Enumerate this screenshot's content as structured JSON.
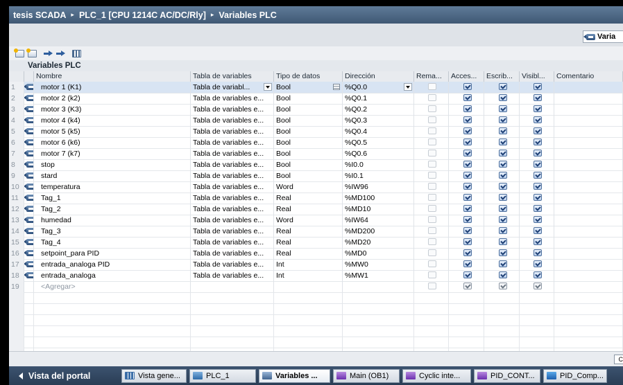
{
  "title_bar": {
    "parts": [
      "tesis SCADA",
      "PLC_1 [CPU 1214C AC/DC/Rly]",
      "Variables PLC"
    ],
    "separator": "▸"
  },
  "editor_tab": {
    "label": "Varia"
  },
  "toolbar": {
    "icons": [
      "add-tag-icon",
      "insert-row-icon",
      "import-icon",
      "export-icon",
      "overview-icon"
    ]
  },
  "section_title": "Variables PLC",
  "columns": [
    "Nombre",
    "Tabla de variables",
    "Tipo de datos",
    "Dirección",
    "Rema...",
    "Acces...",
    "Escrib...",
    "Visibl...",
    "Comentario"
  ],
  "rows": [
    {
      "n": "1",
      "name": "motor 1 (K1)",
      "table": "Tabla de variabl...",
      "type": "Bool",
      "address": "%Q0.0"
    },
    {
      "n": "2",
      "name": "motor 2 (k2)",
      "table": "Tabla de variables e...",
      "type": "Bool",
      "address": "%Q0.1"
    },
    {
      "n": "3",
      "name": "motor 3 (K3)",
      "table": "Tabla de variables e...",
      "type": "Bool",
      "address": "%Q0.2"
    },
    {
      "n": "4",
      "name": "motor 4 (k4)",
      "table": "Tabla de variables e...",
      "type": "Bool",
      "address": "%Q0.3"
    },
    {
      "n": "5",
      "name": "motor 5 (k5)",
      "table": "Tabla de variables e...",
      "type": "Bool",
      "address": "%Q0.4"
    },
    {
      "n": "6",
      "name": "motor 6 (k6)",
      "table": "Tabla de variables e...",
      "type": "Bool",
      "address": "%Q0.5"
    },
    {
      "n": "7",
      "name": "motor 7 (k7)",
      "table": "Tabla de variables e...",
      "type": "Bool",
      "address": "%Q0.6"
    },
    {
      "n": "8",
      "name": "stop",
      "table": "Tabla de variables e...",
      "type": "Bool",
      "address": "%I0.0"
    },
    {
      "n": "9",
      "name": "stard",
      "table": "Tabla de variables e...",
      "type": "Bool",
      "address": "%I0.1"
    },
    {
      "n": "10",
      "name": "temperatura",
      "table": "Tabla de variables e...",
      "type": "Word",
      "address": "%IW96"
    },
    {
      "n": "11",
      "name": "Tag_1",
      "table": "Tabla de variables e...",
      "type": "Real",
      "address": "%MD100"
    },
    {
      "n": "12",
      "name": "Tag_2",
      "table": "Tabla de variables e...",
      "type": "Real",
      "address": "%MD10"
    },
    {
      "n": "13",
      "name": "humedad",
      "table": "Tabla de variables e...",
      "type": "Word",
      "address": "%IW64"
    },
    {
      "n": "14",
      "name": "Tag_3",
      "table": "Tabla de variables e...",
      "type": "Real",
      "address": "%MD200"
    },
    {
      "n": "15",
      "name": "Tag_4",
      "table": "Tabla de variables e...",
      "type": "Real",
      "address": "%MD20"
    },
    {
      "n": "16",
      "name": "setpoint_para PID",
      "table": "Tabla de variables e...",
      "type": "Real",
      "address": "%MD0"
    },
    {
      "n": "17",
      "name": "entrada_analoga PID",
      "table": "Tabla de variables e...",
      "type": "Int",
      "address": "%MW0"
    },
    {
      "n": "18",
      "name": "entrada_analoga",
      "table": "Tabla de variables e...",
      "type": "Int",
      "address": "%MW1"
    }
  ],
  "add_row": {
    "n": "19",
    "label": "<Agregar>"
  },
  "bottom_mini": "C",
  "taskbar": {
    "portal_label": "Vista del portal",
    "tasks": [
      {
        "label": "Vista gene...",
        "icon": "overview-icon"
      },
      {
        "label": "PLC_1",
        "icon": "plc-icon"
      },
      {
        "label": "Variables ...",
        "icon": "tag-table-icon",
        "active": true
      },
      {
        "label": "Main (OB1)",
        "icon": "ob-icon"
      },
      {
        "label": "Cyclic inte...",
        "icon": "ob-icon"
      },
      {
        "label": "PID_CONT...",
        "icon": "ob-icon"
      },
      {
        "label": "PID_Comp...",
        "icon": "drive-icon"
      }
    ]
  },
  "colors": {
    "title_bar": "#4a6480",
    "selected_row": "#d8e4f3",
    "taskbar": "#34496a"
  }
}
